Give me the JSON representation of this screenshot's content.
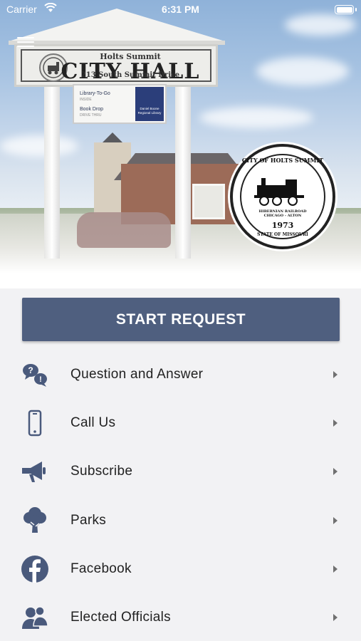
{
  "status_bar": {
    "carrier": "Carrier",
    "time": "6:31 PM"
  },
  "hero": {
    "sign": {
      "top_line": "Holts Summit",
      "main_line": "CITY HALL",
      "address": "213 South Summit Drive"
    },
    "plaque": {
      "row1_title": "Library-To-Go",
      "row1_sub": "INSIDE",
      "row2_title": "Book Drop",
      "row2_sub": "DRIVE THRU",
      "library_name": "Daniel Boone Regional Library"
    },
    "seal": {
      "top_text": "CITY OF HOLTS SUMMIT",
      "ribbon_text": "HIBERNIAN RAILROAD CHICAGO - ALTON",
      "year": "1973",
      "bottom_text": "STATE OF MISSOURI"
    }
  },
  "start_button": {
    "label": "START REQUEST"
  },
  "menu_items": [
    {
      "label": "Question and Answer",
      "icon": "question-bubbles-icon"
    },
    {
      "label": "Call Us",
      "icon": "phone-icon"
    },
    {
      "label": "Subscribe",
      "icon": "megaphone-icon"
    },
    {
      "label": "Parks",
      "icon": "tree-icon"
    },
    {
      "label": "Facebook",
      "icon": "facebook-icon"
    },
    {
      "label": "Elected Officials",
      "icon": "officials-icon"
    }
  ],
  "colors": {
    "accent": "#4f5f7f",
    "icon": "#4a5a7c",
    "background": "#f2f2f4"
  }
}
